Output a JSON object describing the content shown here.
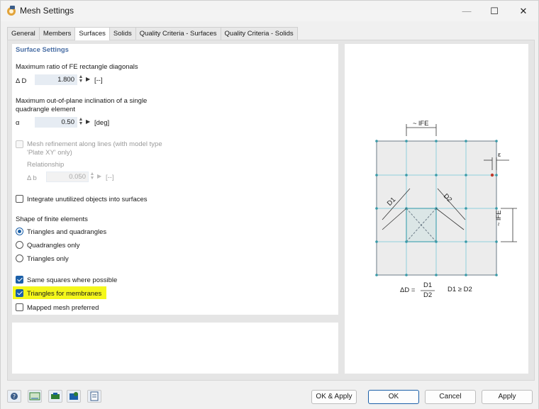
{
  "window": {
    "title": "Mesh Settings",
    "icons": {
      "app": "mesh-app-icon",
      "minimize": "minimize-icon",
      "maximize": "maximize-icon",
      "close": "close-icon"
    },
    "minimize_glyph": "—",
    "maximize_glyph": "☐",
    "close_glyph": "✕"
  },
  "tabs": [
    {
      "label": "General",
      "active": false
    },
    {
      "label": "Members",
      "active": false
    },
    {
      "label": "Surfaces",
      "active": true
    },
    {
      "label": "Solids",
      "active": false
    },
    {
      "label": "Quality Criteria - Surfaces",
      "active": false
    },
    {
      "label": "Quality Criteria - Solids",
      "active": false
    }
  ],
  "surface_settings": {
    "section_title": "Surface Settings",
    "max_ratio": {
      "label": "Maximum ratio of FE rectangle diagonals",
      "symbol": "Δ D",
      "value": "1.800",
      "unit": "[--]"
    },
    "max_inclination": {
      "label_line1": "Maximum out-of-plane inclination of a single",
      "label_line2": "quadrangle element",
      "symbol": "α",
      "value": "0.50",
      "unit": "[deg]"
    },
    "mesh_refinement": {
      "label_line1": "Mesh refinement along lines (with model type",
      "label_line2": "'Plate XY' only)",
      "checked": false,
      "enabled": false,
      "relationship_label": "Relationship",
      "symbol": "Δ b",
      "value": "0.050",
      "unit": "[--]"
    },
    "integrate_unutilized": {
      "label": "Integrate unutilized objects into surfaces",
      "checked": false
    },
    "shape_title": "Shape of finite elements",
    "shapes": [
      {
        "label": "Triangles and quadrangles",
        "selected": true
      },
      {
        "label": "Quadrangles only",
        "selected": false
      },
      {
        "label": "Triangles only",
        "selected": false
      }
    ],
    "same_squares": {
      "label": "Same squares where possible",
      "checked": true
    },
    "triangles_membranes": {
      "label": "Triangles for membranes",
      "checked": true
    },
    "mapped_mesh": {
      "label": "Mapped mesh preferred",
      "checked": false
    }
  },
  "diagram": {
    "lfe_top": "~ lFE",
    "lfe_side": "~ lFE",
    "epsilon": "ε",
    "d1": "D1",
    "d2": "D2",
    "formula_lhs": "ΔD =",
    "formula_num": "D1",
    "formula_den": "D2",
    "formula_cond": "D1 ≥ D2",
    "colors": {
      "grid": "#5fb3c2",
      "mesh_fill": "#ececec",
      "node": "#3a9aa8",
      "accent": "#c0392b"
    }
  },
  "toolbar_icons": [
    "help-icon",
    "units-icon",
    "model-icon",
    "settings-icon",
    "table-icon"
  ],
  "buttons": {
    "ok_apply": "OK & Apply",
    "ok": "OK",
    "cancel": "Cancel",
    "apply": "Apply"
  }
}
